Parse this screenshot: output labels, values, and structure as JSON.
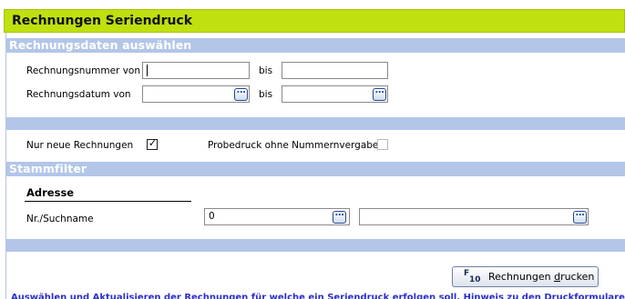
{
  "title": "Rechnungen Seriendruck",
  "sections": {
    "rechnungsdaten": "Rechnungsdaten auswählen",
    "stammfilter": "Stammfilter"
  },
  "rechnungsnummer": {
    "label": "Rechnungsnummer von",
    "von_value": "",
    "bis_label": "bis",
    "bis_value": ""
  },
  "rechnungsdatum": {
    "label": "Rechnungsdatum von",
    "von_value": "",
    "bis_label": "bis",
    "bis_value": ""
  },
  "options": {
    "nur_neue_label": "Nur neue Rechnungen",
    "nur_neue_checked": true,
    "probedruck_label": "Probedruck ohne Nummernvergabe",
    "probedruck_checked": false
  },
  "adresse": {
    "heading": "Adresse",
    "label": "Nr./Suchname",
    "nr_value": "0",
    "name_value": ""
  },
  "dots_glyph": "...",
  "checkmark_glyph": "✓",
  "button": {
    "key_glyph": "F",
    "key_sub": "10",
    "label_prefix": "Rechnungen ",
    "label_underlined": "d",
    "label_suffix": "rucken"
  },
  "footer_text": "Auswählen und Aktualisieren der Rechnungen für welche ein Seriendruck erfolgen soll. Hinweis zu den Druckformularen in den Mandanteneinstellungen."
}
